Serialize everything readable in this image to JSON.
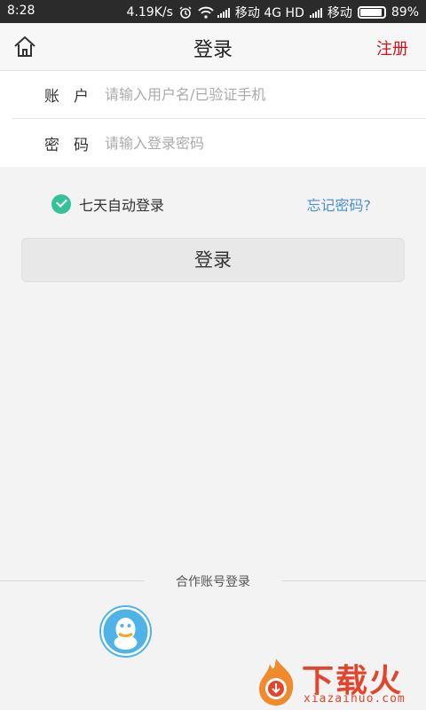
{
  "status_bar": {
    "time": "8:28",
    "speed": "4.19K/s",
    "carrier1": "移动 4G HD",
    "carrier2": "移动",
    "battery": "89%",
    "battery_level": 0.89
  },
  "header": {
    "title": "登录",
    "register_label": "注册",
    "home_icon": "home-icon"
  },
  "form": {
    "account_label": "账户",
    "account_placeholder": "请输入用户名/已验证手机",
    "account_value": "",
    "password_label": "密码",
    "password_placeholder": "请输入登录密码",
    "password_value": ""
  },
  "options": {
    "auto_login_label": "七天自动登录",
    "auto_login_checked": true,
    "forgot_label": "忘记密码?"
  },
  "login_button_label": "登录",
  "partner": {
    "label": "合作账号登录",
    "providers": [
      "qq"
    ]
  },
  "watermark": {
    "text": "下载火",
    "subtext": "xiazaihuo.com"
  },
  "colors": {
    "accent_red": "#d0121b",
    "link_blue": "#4a8fd6",
    "check_green": "#35c29a",
    "qq_blue": "#4fb3e8"
  }
}
